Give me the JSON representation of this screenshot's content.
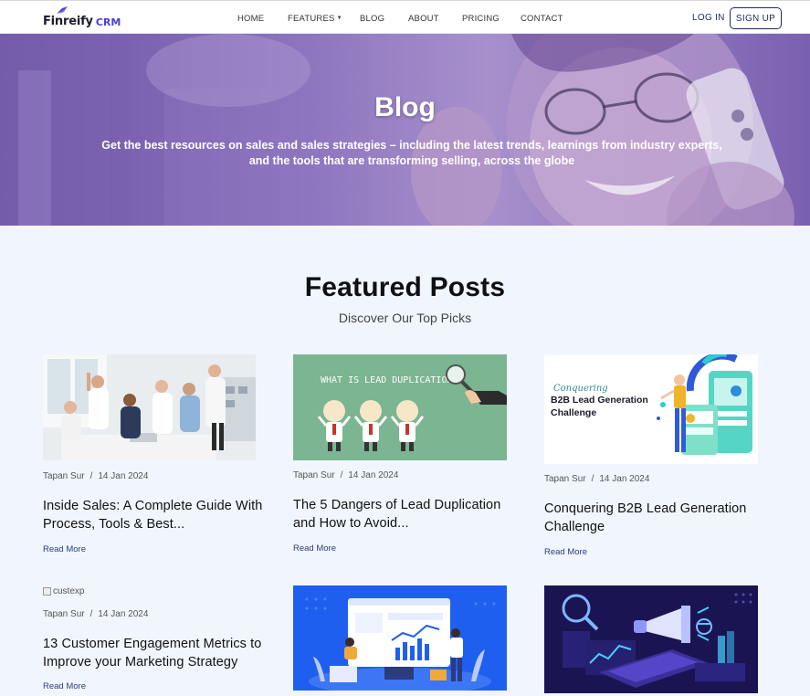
{
  "brand": {
    "name": "Finreify",
    "suffix": "CRM",
    "accent": "#4a3fd6"
  },
  "nav": {
    "items": [
      {
        "label": "HOME"
      },
      {
        "label": "FEATURES",
        "has_caret": true
      },
      {
        "label": "BLOG"
      },
      {
        "label": "ABOUT"
      },
      {
        "label": "PRICING"
      },
      {
        "label": "CONTACT"
      }
    ],
    "login_label": "LOG IN",
    "signup_label": "SIGN UP"
  },
  "hero": {
    "title": "Blog",
    "subtitle": "Get the best resources on sales and sales strategies – including the latest trends, learnings from industry experts, and the tools that are transforming selling, across the globe"
  },
  "featured": {
    "title": "Featured Posts",
    "subtitle": "Discover Our Top Picks"
  },
  "posts": [
    {
      "author": "Tapan Sur",
      "date": "14 Jan 2024",
      "title": "Inside Sales: A Complete Guide With Process, Tools & Best...",
      "read_more": "Read More",
      "image": "team-celebrating-photo"
    },
    {
      "author": "Tapan Sur",
      "date": "14 Jan 2024",
      "title": "The 5 Dangers of Lead Duplication and How to Avoid...",
      "read_more": "Read More",
      "image": "lead-duplication-illustration",
      "image_text": "WHAT IS LEAD DUPLICATION?"
    },
    {
      "author": "Tapan Sur",
      "date": "14 Jan 2024",
      "title": "Conquering B2B Lead Generation Challenge",
      "read_more": "Read More",
      "image": "b2b-lead-generation-illustration",
      "image_text_script": "Conquering",
      "image_text_main": "B2B Lead Generation Challenge"
    },
    {
      "author": "Tapan Sur",
      "date": "14 Jan 2024",
      "title": "13 Customer Engagement Metrics to Improve your Marketing Strategy",
      "read_more": "Read More",
      "image_alt": "custexp"
    },
    {
      "image": "analytics-dashboard-illustration"
    },
    {
      "image": "marketing-megaphone-illustration"
    }
  ]
}
